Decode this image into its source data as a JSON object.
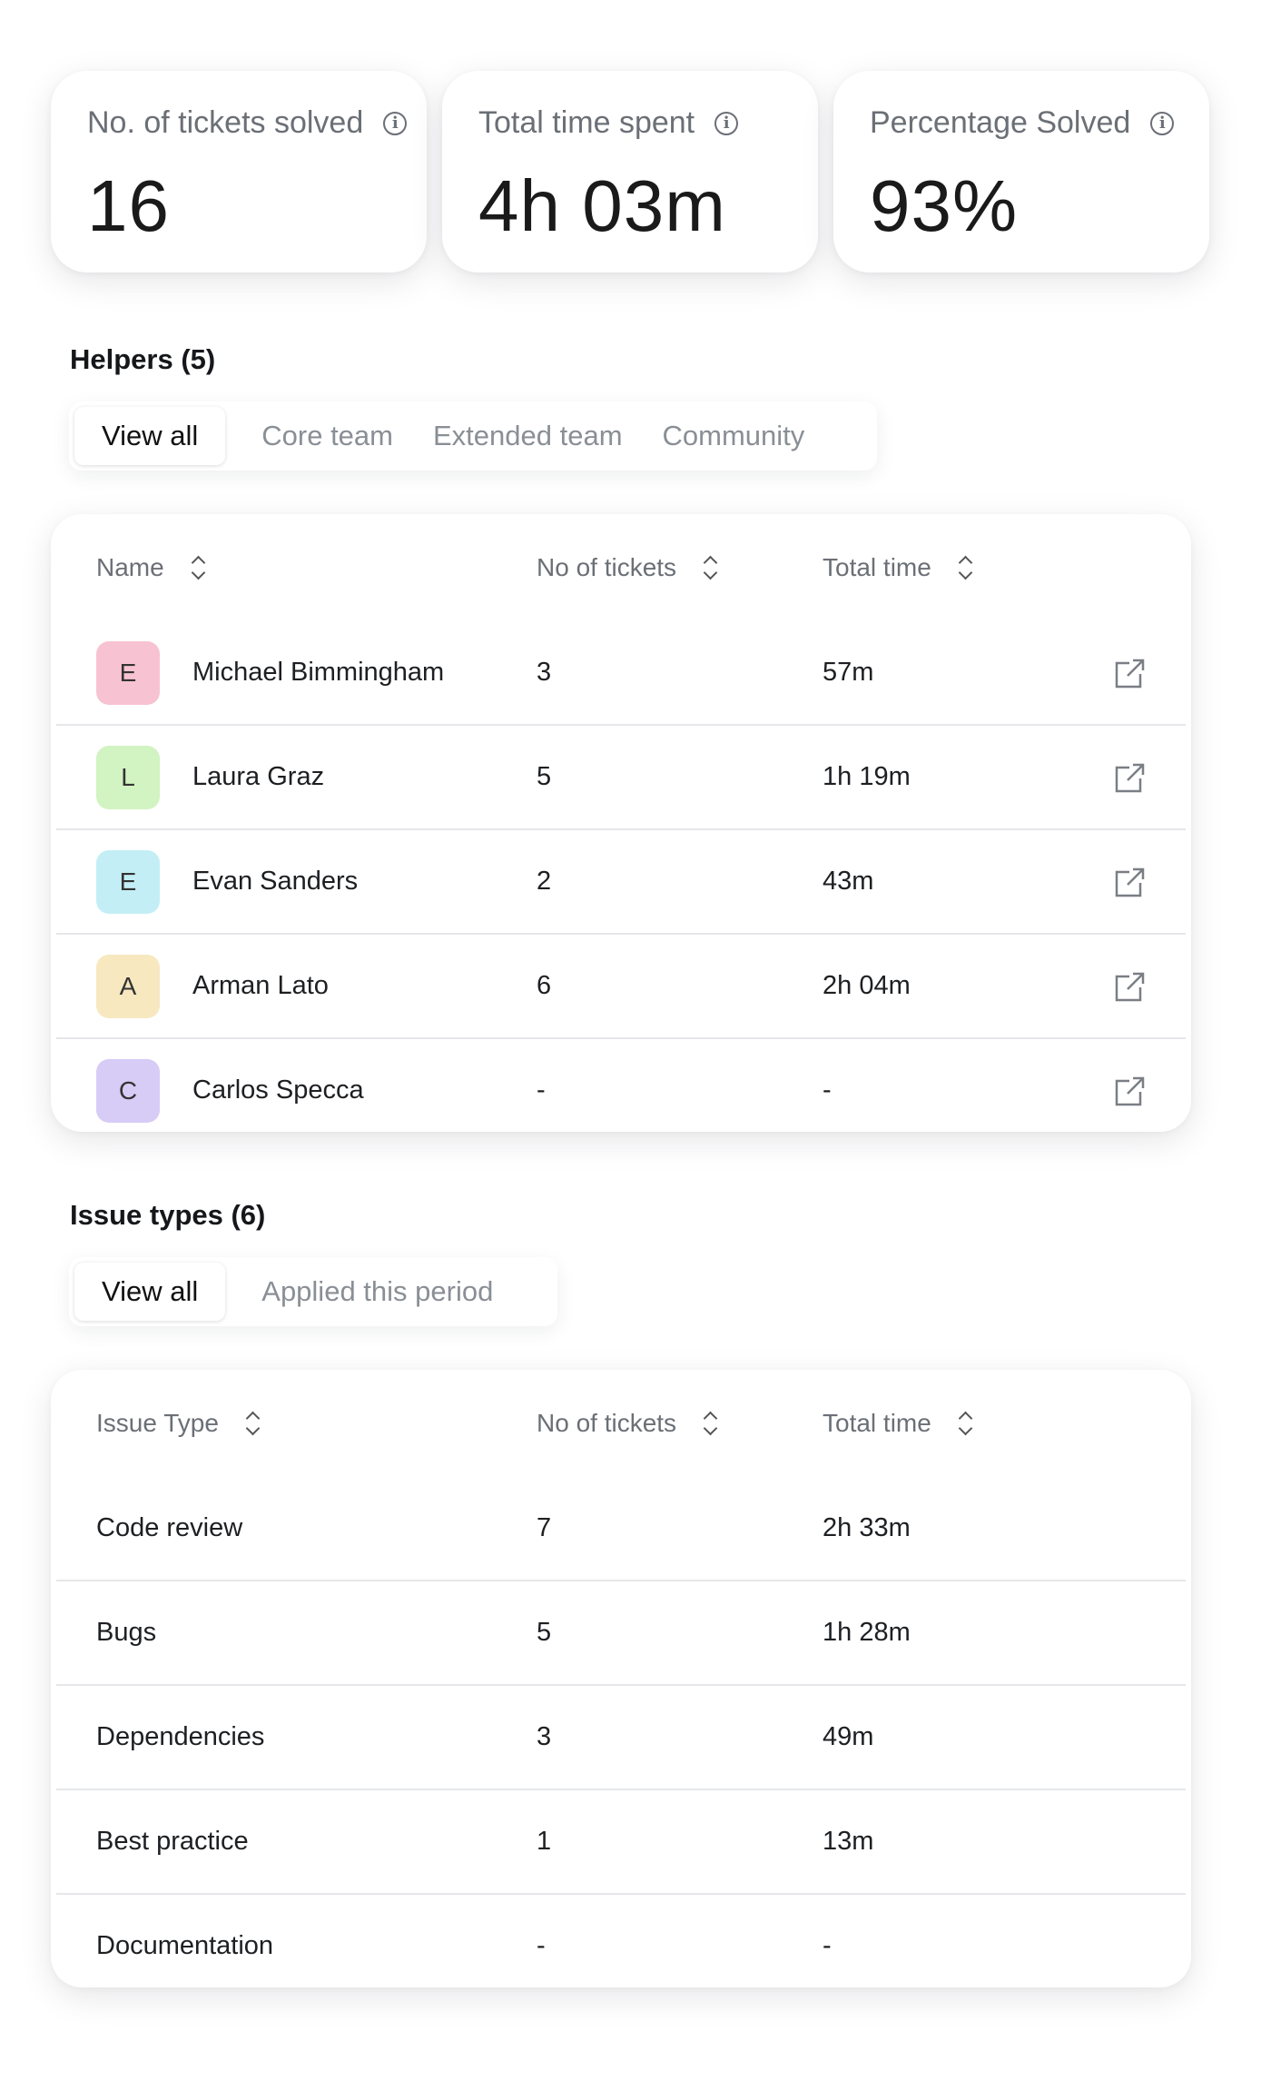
{
  "stats": [
    {
      "label": "No. of tickets solved",
      "value": "16"
    },
    {
      "label": "Total time spent",
      "value": "4h 03m"
    },
    {
      "label": "Percentage Solved",
      "value": "93%"
    }
  ],
  "helpers": {
    "title": "Helpers (5)",
    "filters": [
      "View all",
      "Core team",
      "Extended team",
      "Community"
    ],
    "columns": [
      "Name",
      "No of tickets",
      "Total time"
    ],
    "rows": [
      {
        "initial": "E",
        "avatar_color": "#f7c3d2",
        "name": "Michael Bimmingham",
        "tickets": "3",
        "time": "57m"
      },
      {
        "initial": "L",
        "avatar_color": "#d2f3c2",
        "name": "Laura Graz",
        "tickets": "5",
        "time": "1h 19m"
      },
      {
        "initial": "E",
        "avatar_color": "#c4eef6",
        "name": "Evan Sanders",
        "tickets": "2",
        "time": "43m"
      },
      {
        "initial": "A",
        "avatar_color": "#f7e8c0",
        "name": "Arman Lato",
        "tickets": "6",
        "time": "2h 04m"
      },
      {
        "initial": "C",
        "avatar_color": "#d7ccf6",
        "name": "Carlos Specca",
        "tickets": "-",
        "time": "-"
      }
    ]
  },
  "issues": {
    "title": "Issue types (6)",
    "filters": [
      "View all",
      "Applied this period"
    ],
    "columns": [
      "Issue Type",
      "No of tickets",
      "Total time"
    ],
    "rows": [
      {
        "type": "Code review",
        "tickets": "7",
        "time": "2h 33m"
      },
      {
        "type": "Bugs",
        "tickets": "5",
        "time": "1h 28m"
      },
      {
        "type": "Dependencies",
        "tickets": "3",
        "time": "49m"
      },
      {
        "type": "Best practice",
        "tickets": "1",
        "time": "13m"
      },
      {
        "type": "Documentation",
        "tickets": "-",
        "time": "-"
      }
    ]
  }
}
